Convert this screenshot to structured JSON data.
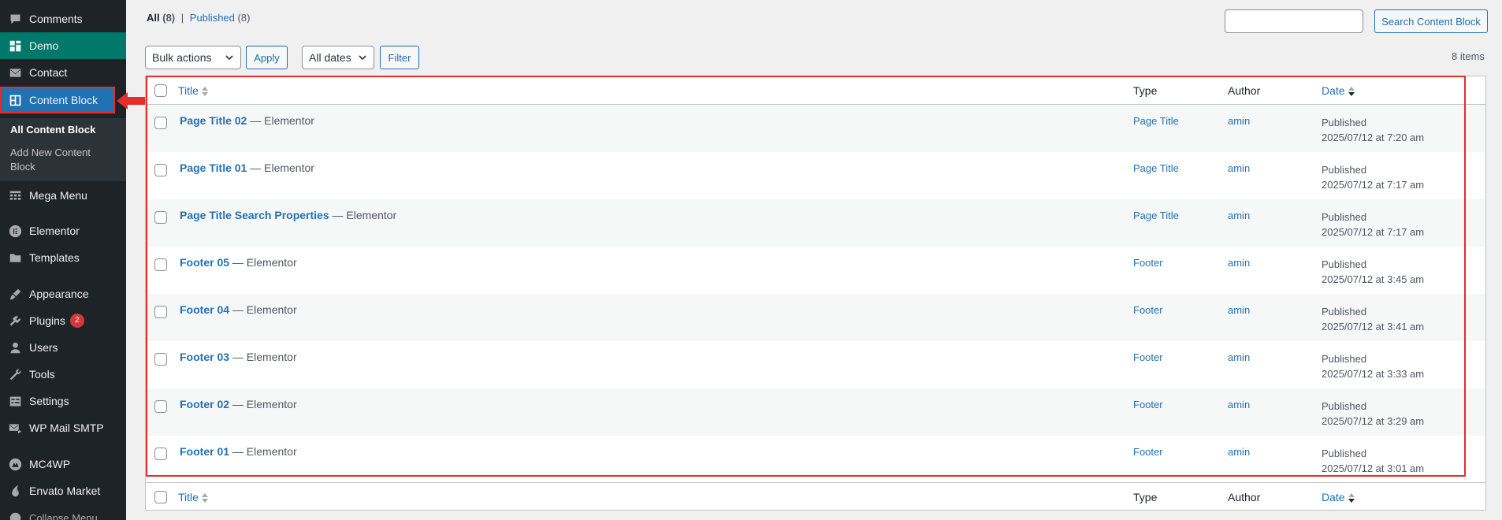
{
  "sidebar": {
    "items": [
      {
        "label": "Comments",
        "icon": "comments-icon"
      },
      {
        "label": "Demo",
        "icon": "dashboard-icon"
      },
      {
        "label": "Contact",
        "icon": "mail-icon"
      },
      {
        "label": "Content Block",
        "icon": "content-block-icon"
      },
      {
        "label": "Mega Menu",
        "icon": "mega-menu-icon"
      },
      {
        "label": "Elementor",
        "icon": "elementor-icon"
      },
      {
        "label": "Templates",
        "icon": "folder-icon"
      },
      {
        "label": "Appearance",
        "icon": "brush-icon"
      },
      {
        "label": "Plugins",
        "icon": "plugin-icon",
        "badge": "2"
      },
      {
        "label": "Users",
        "icon": "user-icon"
      },
      {
        "label": "Tools",
        "icon": "wrench-icon"
      },
      {
        "label": "Settings",
        "icon": "settings-icon"
      },
      {
        "label": "WP Mail SMTP",
        "icon": "smtp-icon"
      },
      {
        "label": "MC4WP",
        "icon": "mc4wp-icon"
      },
      {
        "label": "Envato Market",
        "icon": "envato-icon"
      },
      {
        "label": "Collapse Menu",
        "icon": "collapse-icon"
      }
    ],
    "submenu": {
      "all": "All Content Block",
      "add_new_line1": "Add New Content",
      "add_new_line2": "Block"
    }
  },
  "filters": {
    "all_label": "All",
    "all_count": "(8)",
    "separator": "|",
    "published_label": "Published",
    "published_count": "(8)"
  },
  "search": {
    "button": "Search Content Block",
    "value": ""
  },
  "toolbar": {
    "bulk_actions": "Bulk actions",
    "apply": "Apply",
    "all_dates": "All dates",
    "filter": "Filter",
    "items_count": "8 items"
  },
  "table": {
    "headers": {
      "title": "Title",
      "type": "Type",
      "author": "Author",
      "date": "Date"
    },
    "rows": [
      {
        "title": "Page Title 02",
        "suffix": " — Elementor",
        "type": "Page Title",
        "author": "amin",
        "status": "Published",
        "date": "2025/07/12 at 7:20 am"
      },
      {
        "title": "Page Title 01",
        "suffix": " — Elementor",
        "type": "Page Title",
        "author": "amin",
        "status": "Published",
        "date": "2025/07/12 at 7:17 am"
      },
      {
        "title": "Page Title Search Properties",
        "suffix": " — Elementor",
        "type": "Page Title",
        "author": "amin",
        "status": "Published",
        "date": "2025/07/12 at 7:17 am"
      },
      {
        "title": "Footer 05",
        "suffix": " — Elementor",
        "type": "Footer",
        "author": "amin",
        "status": "Published",
        "date": "2025/07/12 at 3:45 am"
      },
      {
        "title": "Footer 04",
        "suffix": " — Elementor",
        "type": "Footer",
        "author": "amin",
        "status": "Published",
        "date": "2025/07/12 at 3:41 am"
      },
      {
        "title": "Footer 03",
        "suffix": " — Elementor",
        "type": "Footer",
        "author": "amin",
        "status": "Published",
        "date": "2025/07/12 at 3:33 am"
      },
      {
        "title": "Footer 02",
        "suffix": " — Elementor",
        "type": "Footer",
        "author": "amin",
        "status": "Published",
        "date": "2025/07/12 at 3:29 am"
      },
      {
        "title": "Footer 01",
        "suffix": " — Elementor",
        "type": "Footer",
        "author": "amin",
        "status": "Published",
        "date": "2025/07/12 at 3:01 am"
      }
    ]
  },
  "colors": {
    "accent": "#2271b1",
    "sidebar_bg": "#1d2327",
    "demo_bg": "#00786a",
    "highlight": "#e52d2d"
  }
}
